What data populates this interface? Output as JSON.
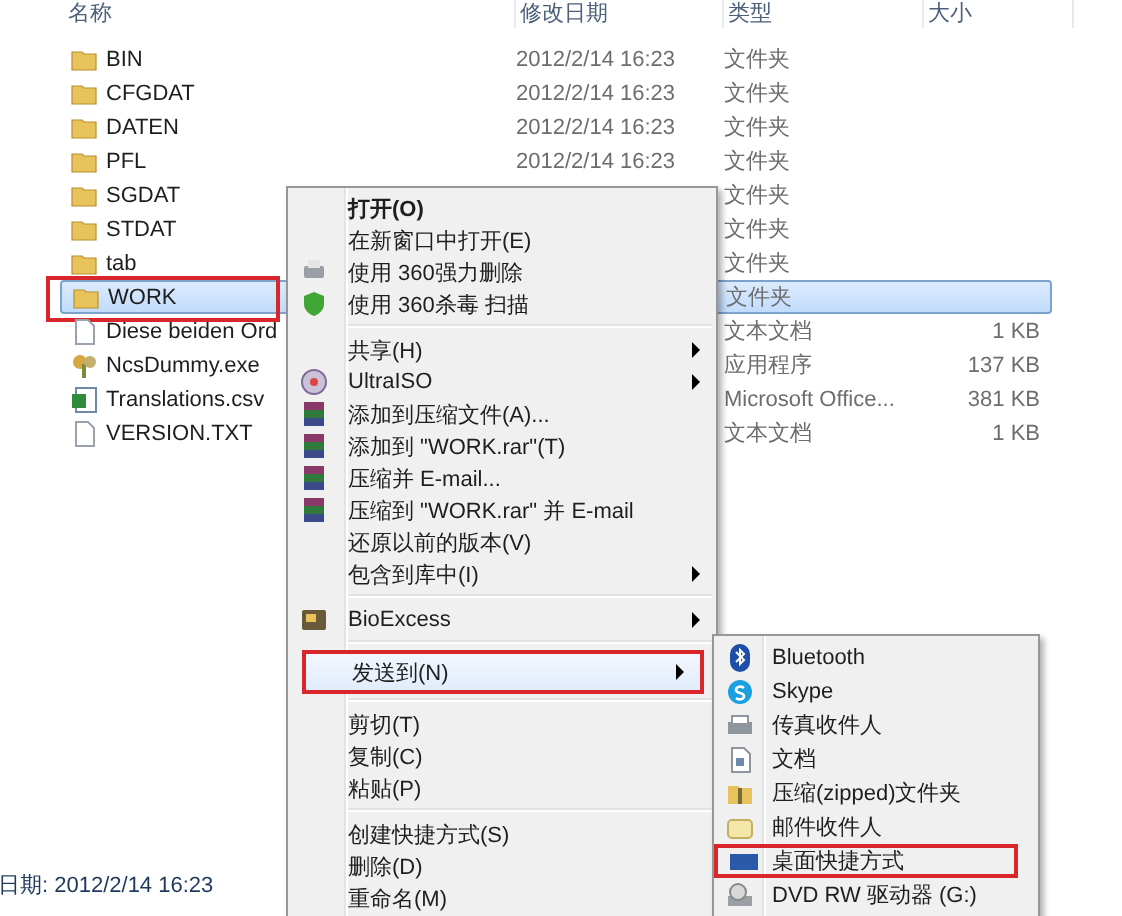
{
  "columns": [
    "名称",
    "修改日期",
    "类型",
    "大小"
  ],
  "files": [
    {
      "name": "BIN",
      "date": "2012/2/14 16:23",
      "type": "文件夹",
      "kind": "folder",
      "selected": false,
      "annotated": false
    },
    {
      "name": "CFGDAT",
      "date": "2012/2/14 16:23",
      "type": "文件夹",
      "kind": "folder",
      "selected": false,
      "annotated": false
    },
    {
      "name": "DATEN",
      "date": "2012/2/14 16:23",
      "type": "文件夹",
      "kind": "folder",
      "selected": false,
      "annotated": false
    },
    {
      "name": "PFL",
      "date": "2012/2/14 16:23",
      "type": "文件夹",
      "kind": "folder",
      "selected": false,
      "annotated": false
    },
    {
      "name": "SGDAT",
      "type": "文件夹",
      "kind": "folder",
      "selected": false,
      "annotated": false
    },
    {
      "name": "STDAT",
      "type": "文件夹",
      "kind": "folder",
      "selected": false,
      "annotated": false
    },
    {
      "name": "tab",
      "type": "文件夹",
      "kind": "folder",
      "selected": false,
      "annotated": false
    },
    {
      "name": "WORK",
      "type": "文件夹",
      "kind": "folder",
      "selected": true,
      "annotated": true
    },
    {
      "name": "Diese beiden Ord",
      "type": "文本文档",
      "size": "1 KB",
      "kind": "text",
      "selected": false,
      "annotated": false
    },
    {
      "name": "NcsDummy.exe",
      "type": "应用程序",
      "size": "137 KB",
      "kind": "exe",
      "selected": false,
      "annotated": false
    },
    {
      "name": "Translations.csv",
      "type": "Microsoft Office...",
      "size": "381 KB",
      "kind": "csv",
      "selected": false,
      "annotated": false
    },
    {
      "name": "VERSION.TXT",
      "type": "文本文档",
      "size": "1 KB",
      "kind": "text",
      "selected": false,
      "annotated": false
    }
  ],
  "status": "日期: 2012/2/14 16:23",
  "context_menu": [
    [
      {
        "label": "打开(O)",
        "bold": true
      },
      {
        "label": "在新窗口中打开(E)"
      },
      {
        "label": "使用 360强力删除"
      },
      {
        "label": "使用 360杀毒 扫描"
      }
    ],
    [
      {
        "label": "共享(H)",
        "submenu": true
      },
      {
        "label": "UltraISO",
        "submenu": true
      },
      {
        "label": "添加到压缩文件(A)..."
      },
      {
        "label": "添加到 \"WORK.rar\"(T)"
      },
      {
        "label": "压缩并 E-mail..."
      },
      {
        "label": "压缩到 \"WORK.rar\" 并 E-mail"
      },
      {
        "label": "还原以前的版本(V)"
      },
      {
        "label": "包含到库中(I)",
        "submenu": true
      }
    ],
    [
      {
        "label": "BioExcess",
        "submenu": true
      }
    ],
    [
      {
        "label": "发送到(N)",
        "submenu": true,
        "annotated": true
      }
    ],
    [
      {
        "label": "剪切(T)"
      },
      {
        "label": "复制(C)"
      },
      {
        "label": "粘贴(P)"
      }
    ],
    [
      {
        "label": "创建快捷方式(S)"
      },
      {
        "label": "删除(D)"
      },
      {
        "label": "重命名(M)"
      }
    ]
  ],
  "send_to": [
    {
      "label": "Bluetooth",
      "annotated": false
    },
    {
      "label": "Skype",
      "annotated": false
    },
    {
      "label": "传真收件人",
      "annotated": false
    },
    {
      "label": "文档",
      "annotated": false
    },
    {
      "label": "压缩(zipped)文件夹",
      "annotated": false
    },
    {
      "label": "邮件收件人",
      "annotated": false
    },
    {
      "label": "桌面快捷方式",
      "annotated": true
    },
    {
      "label": "DVD RW 驱动器 (G:)",
      "annotated": false
    }
  ]
}
